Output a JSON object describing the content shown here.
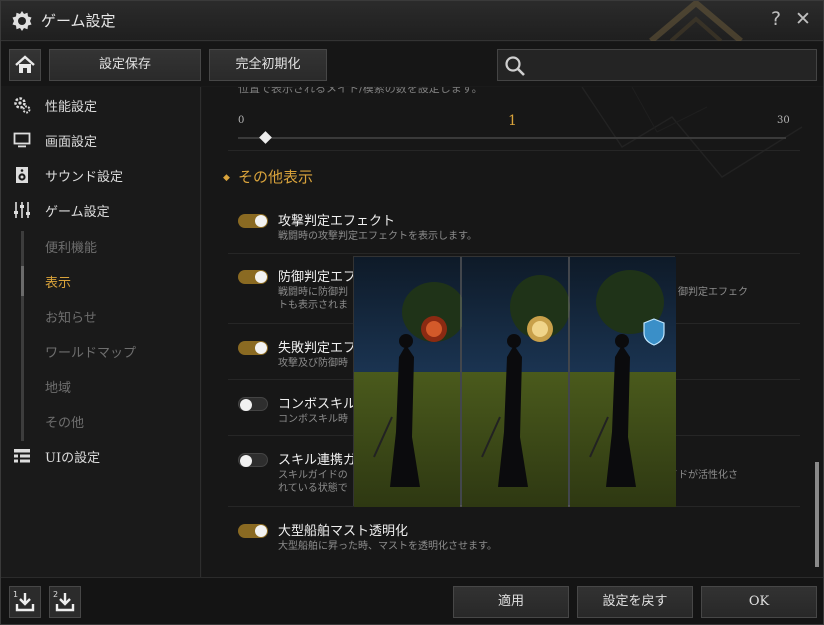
{
  "window": {
    "title": "ゲーム設定",
    "help": "?",
    "close": "✕"
  },
  "toolbar": {
    "save_label": "設定保存",
    "reset_label": "完全初期化",
    "search_placeholder": ""
  },
  "sidebar": {
    "items": [
      {
        "label": "性能設定",
        "icon": "gears-icon"
      },
      {
        "label": "画面設定",
        "icon": "monitor-icon"
      },
      {
        "label": "サウンド設定",
        "icon": "speaker-icon"
      },
      {
        "label": "ゲーム設定",
        "icon": "sliders-icon"
      },
      {
        "label": "UIの設定",
        "icon": "ui-layout-icon"
      }
    ],
    "subitems": [
      {
        "label": "便利機能"
      },
      {
        "label": "表示",
        "active": true
      },
      {
        "label": "お知らせ"
      },
      {
        "label": "ワールドマップ"
      },
      {
        "label": "地域"
      },
      {
        "label": "その他"
      }
    ]
  },
  "content": {
    "cut_text": "位置で表示されるメイト/模索の数を設定します。",
    "slider": {
      "min": "0",
      "max": "30",
      "value": "1",
      "fraction": 0.033
    },
    "section_title": "その他表示",
    "options": [
      {
        "title": "攻撃判定エフェクト",
        "desc": "戦闘時の攻撃判定エフェクトを表示します。",
        "on": true
      },
      {
        "title": "防御判定エフ",
        "desc1": "戦闘時に防御判",
        "desc2": "トも表示されま",
        "desc_right": "御判定エフェク",
        "on": true
      },
      {
        "title": "失敗判定エフ",
        "desc": "攻撃及び防御時",
        "on": true
      },
      {
        "title": "コンボスキル",
        "desc": "コンボスキル時",
        "on": false
      },
      {
        "title": "スキル連携ガ",
        "desc1": "スキルガイドの",
        "desc2": "れている状態で",
        "desc_right": "イドが活性化さ",
        "on": false
      },
      {
        "title": "大型船舶マスト透明化",
        "desc": "大型船舶に昇った時、マストを透明化させます。",
        "on": true
      }
    ]
  },
  "footer": {
    "apply_label": "適用",
    "revert_label": "設定を戻す",
    "ok_label": "OK",
    "export1": "1",
    "export2": "2"
  },
  "colors": {
    "accent": "#d9a33b",
    "toggle_on": "#8a6a22"
  }
}
